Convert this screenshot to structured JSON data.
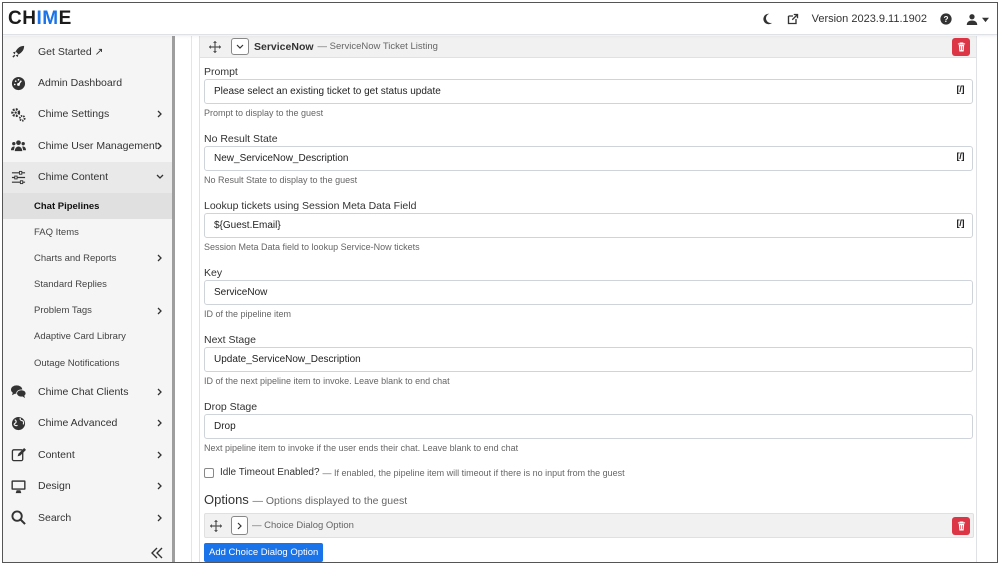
{
  "app": {
    "logo_part1": "CH",
    "logo_accent": "IM",
    "logo_part2": "E",
    "version": "Version 2023.9.11.1902"
  },
  "sidebar": {
    "items": [
      {
        "label": "Get Started ↗",
        "icon": "rocket-icon"
      },
      {
        "label": "Admin Dashboard",
        "icon": "dashboard-gauge-icon"
      },
      {
        "label": "Chime Settings",
        "icon": "cogs-icon"
      },
      {
        "label": "Chime User Management",
        "icon": "users-icon"
      },
      {
        "label": "Chime Content",
        "icon": "sliders-icon"
      }
    ],
    "sub_items": [
      {
        "label": "Chat Pipelines"
      },
      {
        "label": "FAQ Items"
      },
      {
        "label": "Charts and Reports"
      },
      {
        "label": "Standard Replies"
      },
      {
        "label": "Problem Tags"
      },
      {
        "label": "Adaptive Card Library"
      },
      {
        "label": "Outage Notifications"
      }
    ],
    "bottom_items": [
      {
        "label": "Chime Chat Clients",
        "icon": "comments-icon"
      },
      {
        "label": "Chime Advanced",
        "icon": "globe-icon"
      },
      {
        "label": "Content",
        "icon": "edit-icon"
      },
      {
        "label": "Design",
        "icon": "desktop-icon"
      },
      {
        "label": "Search",
        "icon": "search-icon"
      }
    ]
  },
  "card": {
    "title": "ServiceNow",
    "subtitle": "— ServiceNow Ticket Listing"
  },
  "fields": {
    "prompt": {
      "label": "Prompt",
      "value": "Please select an existing ticket to get status update",
      "help": "Prompt to display to the guest",
      "bracket": "[/]"
    },
    "no_result": {
      "label": "No Result State",
      "value": "New_ServiceNow_Description",
      "help": "No Result State to display to the guest",
      "bracket": "[/]"
    },
    "lookup": {
      "label": "Lookup tickets using Session Meta Data Field",
      "value": "${Guest.Email}",
      "help": "Session Meta Data field to lookup Service-Now tickets",
      "bracket": "[/]"
    },
    "key": {
      "label": "Key",
      "value": "ServiceNow",
      "help": "ID of the pipeline item"
    },
    "next_stage": {
      "label": "Next Stage",
      "value": "Update_ServiceNow_Description",
      "help": "ID of the next pipeline item to invoke. Leave blank to end chat"
    },
    "drop_stage": {
      "label": "Drop Stage",
      "value": "Drop",
      "help": "Next pipeline item to invoke if the user ends their chat. Leave blank to end chat"
    }
  },
  "idle_timeout": {
    "label": "Idle Timeout Enabled?",
    "hint": "— If enabled, the pipeline item will timeout if there is no input from the guest",
    "checked": false
  },
  "options": {
    "title": "Options",
    "subtitle": "— Options displayed to the guest",
    "item_label": "— Choice Dialog Option",
    "add_button": "Add Choice Dialog Option"
  },
  "colors": {
    "accent": "#1a73e8",
    "danger": "#dc3545"
  }
}
